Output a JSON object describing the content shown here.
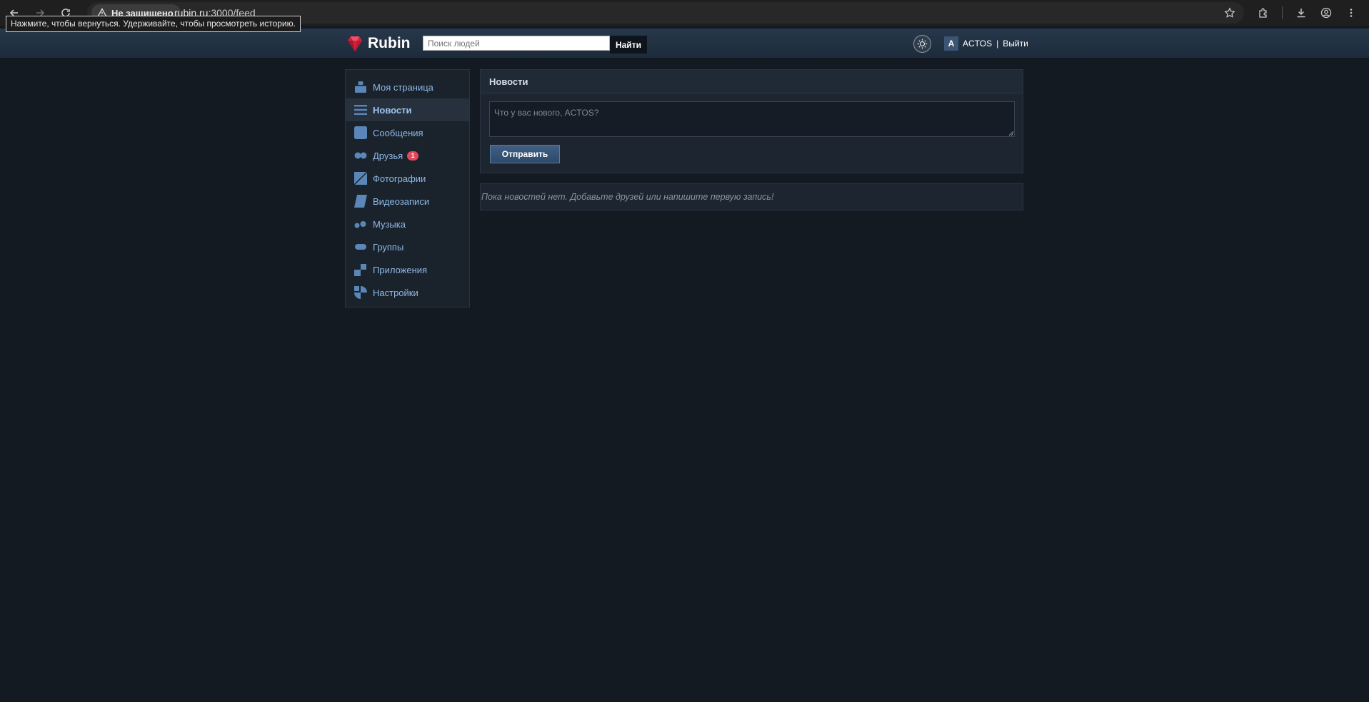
{
  "browser": {
    "security_label": "Не защищено",
    "url_host": "rubin.ru",
    "url_path": ":3000/feed",
    "back_tooltip": "Нажмите, чтобы вернуться. Удерживайте, чтобы просмотреть историю.",
    "icons": [
      "back-arrow-icon",
      "forward-arrow-icon",
      "reload-icon",
      "warning-icon",
      "star-icon",
      "extensions-icon",
      "download-icon",
      "profile-icon",
      "kebab-menu-icon"
    ]
  },
  "header": {
    "logo_text": "Rubin",
    "search_placeholder": "Поиск людей",
    "search_button": "Найти",
    "user_initial": "A",
    "user_name": "ACTOS",
    "separator": "|",
    "logout": "Выйти",
    "colors": {
      "bar_top": "#27384b",
      "bar_bottom": "#1d2b3b",
      "logo_red": "#d3223c"
    }
  },
  "sidebar": {
    "items": [
      {
        "label": "Моя страница",
        "icon": "profile-icon",
        "active": false
      },
      {
        "label": "Новости",
        "icon": "news-list-icon",
        "active": true
      },
      {
        "label": "Сообщения",
        "icon": "messages-icon",
        "active": false
      },
      {
        "label": "Друзья",
        "icon": "friends-icon",
        "active": false,
        "badge": "1"
      },
      {
        "label": "Фотографии",
        "icon": "photos-icon",
        "active": false
      },
      {
        "label": "Видеозаписи",
        "icon": "videos-icon",
        "active": false
      },
      {
        "label": "Музыка",
        "icon": "music-icon",
        "active": false
      },
      {
        "label": "Группы",
        "icon": "groups-icon",
        "active": false
      },
      {
        "label": "Приложения",
        "icon": "apps-icon",
        "active": false
      },
      {
        "label": "Настройки",
        "icon": "settings-icon",
        "active": false
      }
    ],
    "colors": {
      "link": "#8fb9e6",
      "icon": "#5b86b8",
      "badge": "#e0485b"
    }
  },
  "news": {
    "title": "Новости",
    "composer_placeholder": "Что у вас нового, ACTOS?",
    "submit_label": "Отправить",
    "empty_message": "Пока новостей нет. Добавьте друзей или напишите первую запись!"
  }
}
